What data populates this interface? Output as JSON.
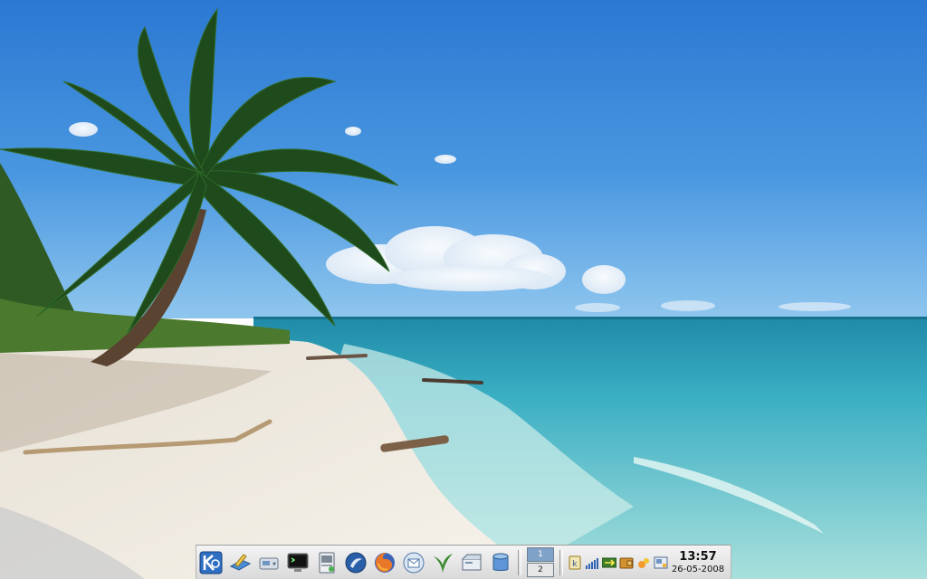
{
  "desktop": {
    "wallpaper": "tropical-beach",
    "colors": {
      "sky_top": "#2f7fd6",
      "sky_horizon": "#8cc4ee",
      "sea": "#49b3c8",
      "sand": "#efe9df"
    }
  },
  "panel": {
    "launchers": [
      {
        "name": "kde-menu",
        "icon": "kde-k-icon"
      },
      {
        "name": "home",
        "icon": "home-folder-icon"
      },
      {
        "name": "system",
        "icon": "system-icon"
      },
      {
        "name": "konsole",
        "icon": "terminal-icon"
      },
      {
        "name": "kate",
        "icon": "text-editor-icon"
      },
      {
        "name": "konqueror",
        "icon": "browser-icon"
      },
      {
        "name": "firefox",
        "icon": "firefox-icon"
      },
      {
        "name": "kontact",
        "icon": "mail-icon"
      },
      {
        "name": "amarok",
        "icon": "music-icon"
      },
      {
        "name": "kpresenter",
        "icon": "office-icon"
      },
      {
        "name": "database",
        "icon": "database-icon"
      }
    ],
    "pager": {
      "desktops": [
        "1",
        "2"
      ],
      "active_index": 0
    },
    "tray": [
      {
        "name": "klipper",
        "icon": "clipboard-icon"
      },
      {
        "name": "signal",
        "icon": "signal-strength-icon"
      },
      {
        "name": "network",
        "icon": "network-icon"
      },
      {
        "name": "wallet",
        "icon": "wallet-icon"
      },
      {
        "name": "updater",
        "icon": "updater-icon"
      },
      {
        "name": "printer",
        "icon": "printer-icon"
      }
    ],
    "clock": {
      "time": "13:57",
      "date": "26-05-2008"
    }
  }
}
